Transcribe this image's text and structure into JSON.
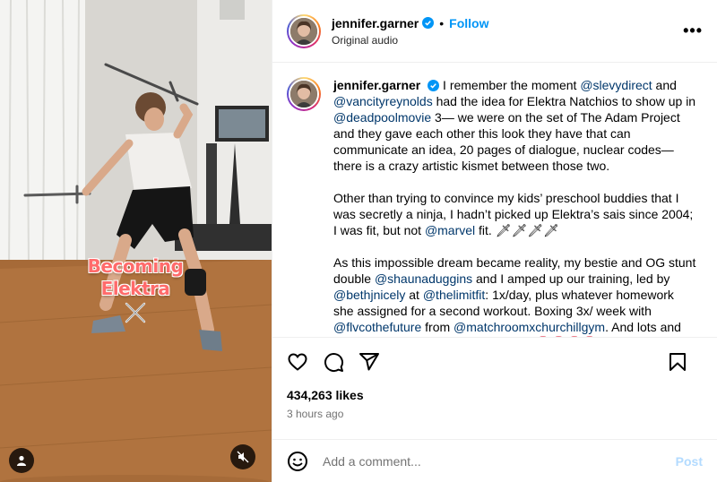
{
  "post": {
    "username": "jennifer.garner",
    "follow_label": "Follow",
    "dot": "•",
    "audio": "Original audio",
    "more_label": "•••"
  },
  "media": {
    "overlay_line1": "Becoming",
    "overlay_line2": "Elektra"
  },
  "caption": {
    "username": "jennifer.garner",
    "p1": [
      {
        "t": "I remember the moment "
      },
      {
        "m": "@slevydirect"
      },
      {
        "t": " and "
      },
      {
        "m": "@vancityreynolds"
      },
      {
        "t": " had the idea for Elektra Natchios to show up in "
      },
      {
        "m": "@deadpoolmovie"
      },
      {
        "t": " 3— we were on the set of The Adam Project and they gave each other this look they have that can communicate an idea, 20 pages of dialogue, nuclear codes— there is a crazy artistic kismet between those two."
      }
    ],
    "p2": [
      {
        "t": "Other than trying to convince my kids’ preschool buddies that I was secretly a ninja, I hadn’t picked up Elektra’s sais since 2004; I was fit, but not "
      },
      {
        "m": "@marvel"
      },
      {
        "t": " fit. 🗡🗡🗡🗡"
      }
    ],
    "p3": [
      {
        "t": "As this impossible dream became reality, my bestie and OG stunt double "
      },
      {
        "m": "@shaunaduggins"
      },
      {
        "t": " and I amped up our training, led by "
      },
      {
        "m": "@bethjnicely"
      },
      {
        "t": " at "
      },
      {
        "m": "@thelimitfit"
      },
      {
        "t": ": 1x/day, plus whatever homework she assigned for a second workout. Boxing 3x/ week with "
      },
      {
        "m": "@flvcothefuture"
      },
      {
        "t": " from "
      },
      {
        "m": "@matchroomxchurchillgym"
      },
      {
        "t": ". And lots and lots of "
      },
      {
        "m": "@onepeloton"
      },
      {
        "t": "’s "
      },
      {
        "m": "@bossgentry"
      },
      {
        "t": " 🥊🥊🥊🥊. We had"
      }
    ]
  },
  "stats": {
    "likes": "434,263 likes",
    "time": "3 hours ago"
  },
  "comment": {
    "placeholder": "Add a comment...",
    "post_label": "Post"
  },
  "colors": {
    "link": "#00376b",
    "accent": "#0095f6",
    "post_disabled": "#b3dbff"
  },
  "icons": [
    "verified-badge-icon",
    "more-icon",
    "heart-icon",
    "comment-icon",
    "share-icon",
    "bookmark-icon",
    "emoji-icon",
    "user-tag-icon",
    "mute-icon",
    "crossed-swords-icon"
  ]
}
